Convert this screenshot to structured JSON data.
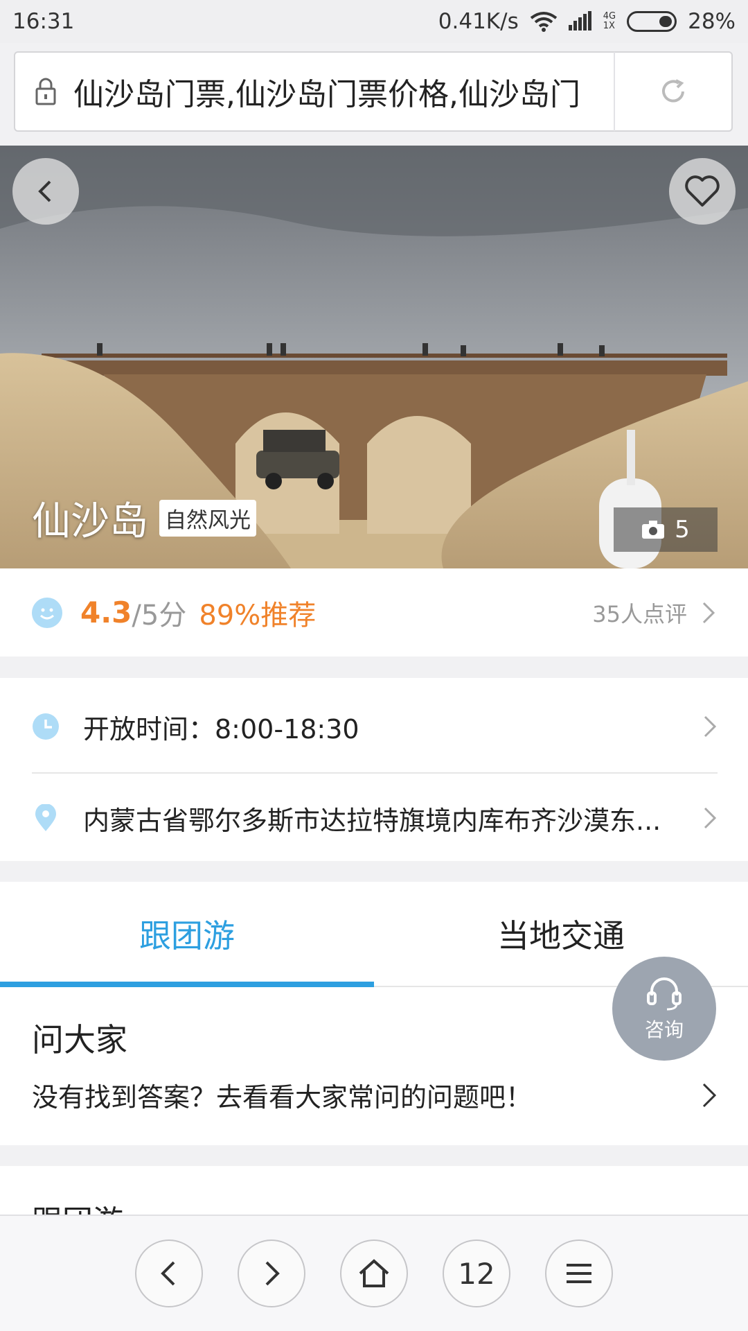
{
  "status_bar": {
    "time": "16:31",
    "net_speed": "0.41K/s",
    "signal_top": "4G",
    "signal_bottom": "1X",
    "battery": "28%"
  },
  "url_bar": {
    "url_text": "仙沙岛门票,仙沙岛门票价格,仙沙岛门"
  },
  "hero": {
    "name": "仙沙岛",
    "tag": "自然风光",
    "photo_count": "5"
  },
  "rating": {
    "score": "4.3",
    "out_of": "/5分",
    "recommend": "89%推荐",
    "reviews": "35人点评"
  },
  "info": {
    "hours": "开放时间：8:00-18:30",
    "address": "内蒙古省鄂尔多斯市达拉特旗境内库布齐沙漠东..."
  },
  "tabs": [
    {
      "label": "跟团游",
      "active": true
    },
    {
      "label": "当地交通",
      "active": false
    }
  ],
  "ask": {
    "title": "问大家",
    "link": "没有找到答案？去看看大家常问的问题吧！"
  },
  "consult": {
    "label": "咨询"
  },
  "next_section": {
    "title": "跟团游"
  },
  "toolbar": {
    "tabs_count": "12"
  },
  "colors": {
    "accent_blue": "#2d9fe0",
    "accent_orange": "#f0822a"
  }
}
